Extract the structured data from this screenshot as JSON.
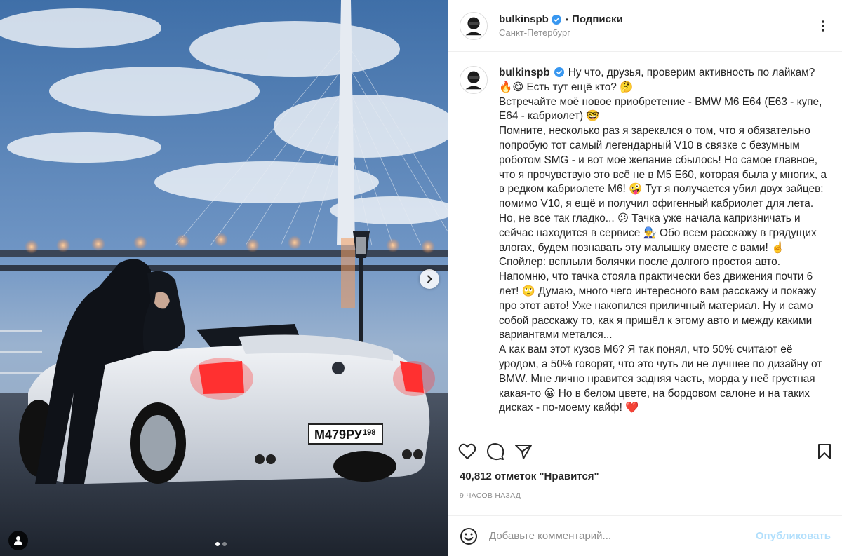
{
  "post": {
    "username": "bulkinspb",
    "follow_label": "Подписки",
    "separator": "•",
    "location": "Санкт-Петербург",
    "avatar_text": "BULKIN",
    "caption_paragraphs": [
      "Ну что, друзья, проверим активность по лайкам? 🔥😋 Есть тут ещё кто? 🤔",
      "Встречайте моё новое приобретение - BMW M6 E64 (E63 - купе, E64 - кабриолет) 🤓",
      "Помните, несколько раз я зарекался о том, что я обязательно попробую тот самый легендарный V10 в связке с безумным роботом SMG - и вот моё желание сбылось! Но самое главное, что я прочувствую это всё не в M5 E60, которая была у многих, а в редком кабриолете M6! 🤪 Тут я получается убил двух зайцев: помимо V10, я ещё и получил офигенный кабриолет для лета. Но, не все так гладко... 😕 Тачка уже начала капризничать и сейчас находится в сервисе 👨‍🔧 Обо всем расскажу в грядущих влогах, будем познавать эту малышку вместе с вами! ☝️ Спойлер: всплыли болячки после долгого простоя авто. Напомню, что тачка стояла практически без движения почти 6 лет! 🙄 Думаю, много чего интересного вам расскажу и покажу про этот авто! Уже накопился приличный материал. Ну и само собой расскажу то, как я пришёл к этому авто и между какими вариантами метался...",
      "А как вам этот кузов M6? Я так понял, что 50% считают её уродом, а 50% говорят, что это чуть ли не лучшее по дизайну от BMW. Мне лично нравится задняя часть, морда у неё грустная какая-то 😀 Но в белом цвете, на бордовом салоне и на таких дисках - по-моему кайф! ❤️"
    ],
    "likes_text": "40,812 отметок \"Нравится\"",
    "time_ago": "9 часов назад",
    "comment_placeholder": "Добавьте комментарий...",
    "publish_label": "Опубликовать",
    "plate_text": "М479РУ",
    "plate_region": "198",
    "carousel": {
      "count": 2,
      "active_index": 0
    }
  },
  "colors": {
    "verified": "#3897f0",
    "publish_disabled": "#b2dffc",
    "secondary_text": "#8e8e8e",
    "border": "#efefef"
  },
  "icons": {
    "verified": "verified-badge-icon",
    "more": "more-options-icon",
    "like": "heart-icon",
    "comment": "comment-bubble-icon",
    "share": "paper-plane-icon",
    "save": "bookmark-icon",
    "emoji": "smiley-icon",
    "tags": "user-tag-icon",
    "next": "chevron-right-icon"
  }
}
